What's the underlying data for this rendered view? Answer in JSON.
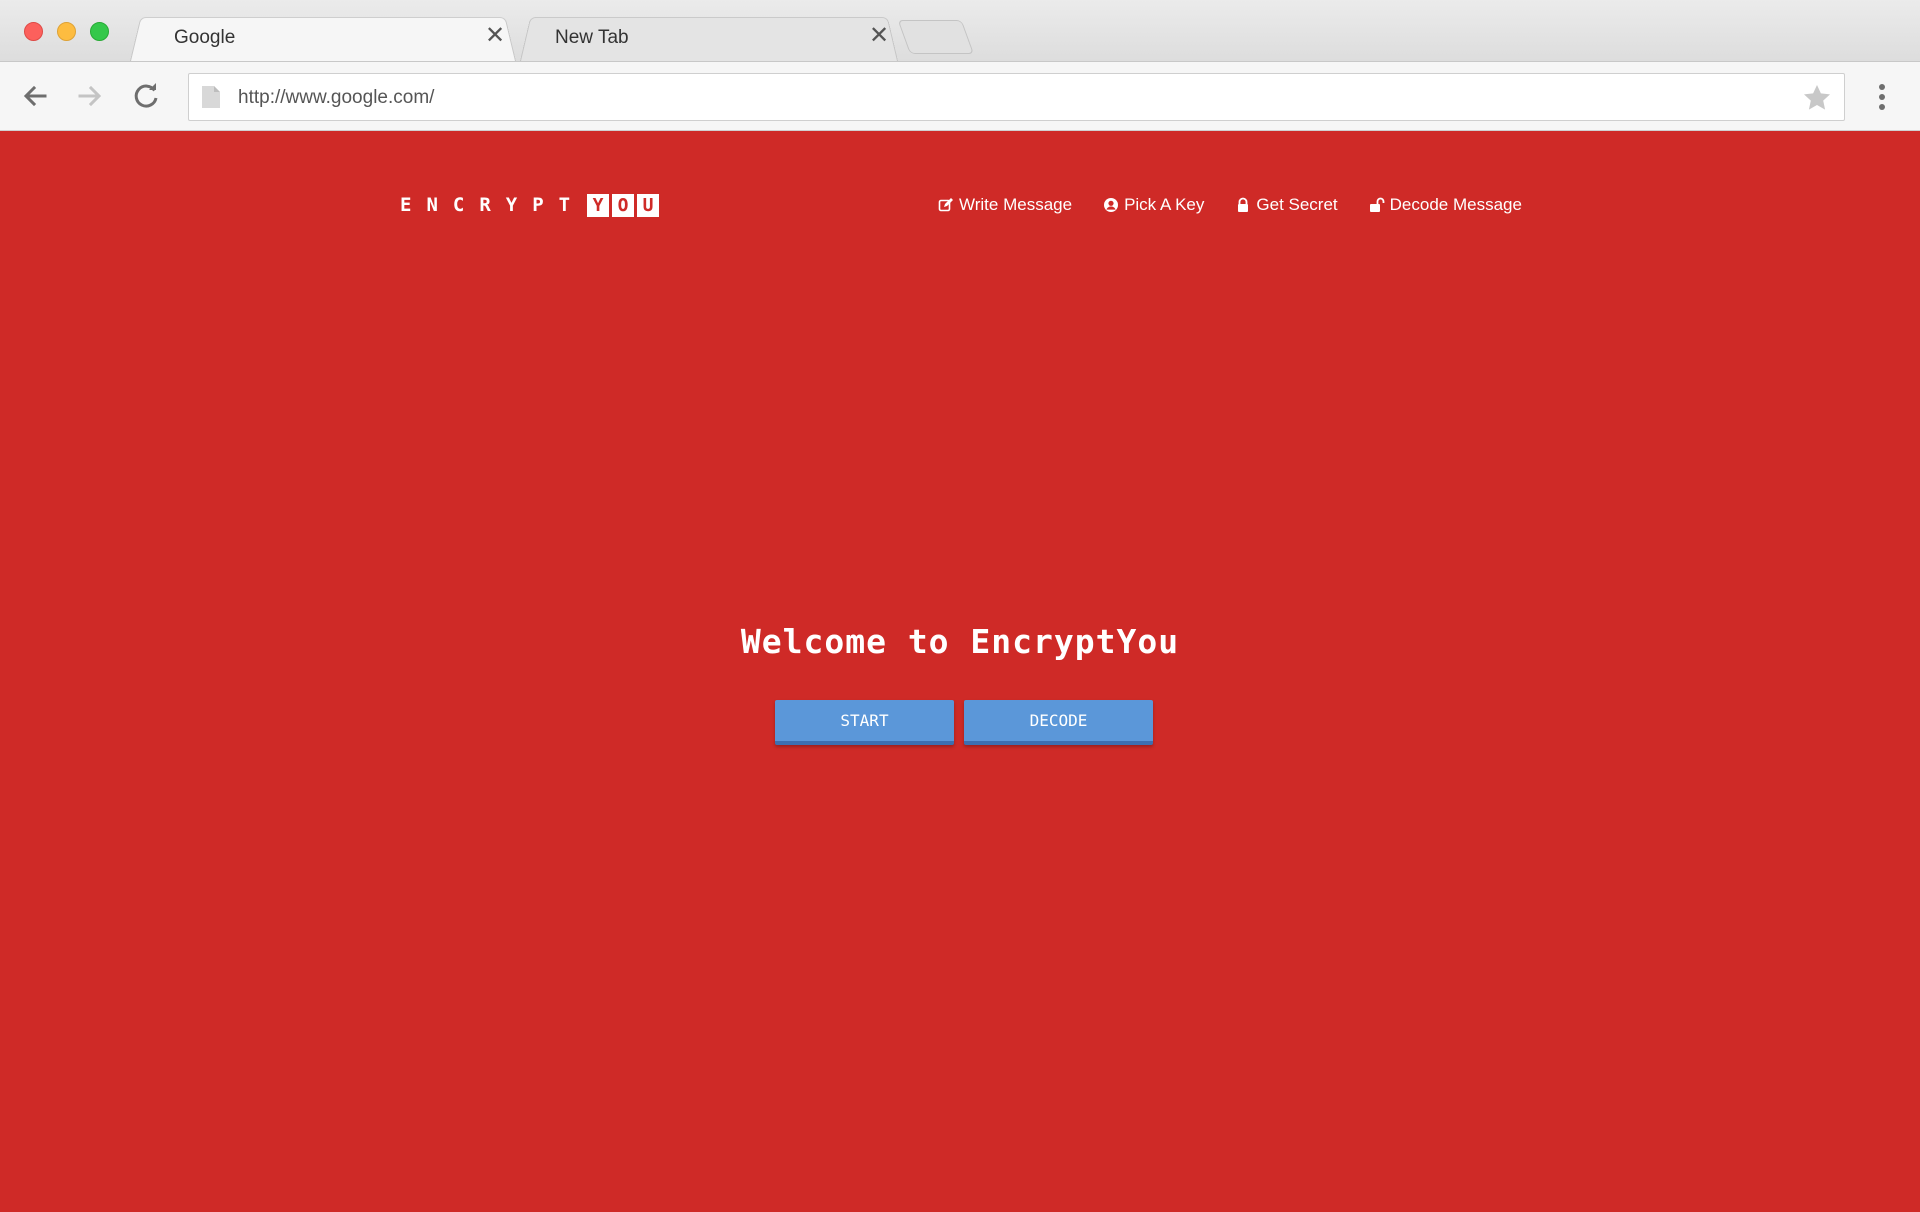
{
  "browser": {
    "tabs": [
      {
        "title": "Google",
        "active": true
      },
      {
        "title": "New Tab",
        "active": false
      }
    ],
    "close_glyph": "✕",
    "url": "http://www.google.com/",
    "icons": [
      "back-arrow-icon",
      "forward-arrow-icon",
      "reload-icon",
      "page-icon",
      "bookmark-star-icon",
      "menu-kebab-icon"
    ]
  },
  "site": {
    "logo": {
      "part1": "ENCRYPT",
      "part2": [
        "Y",
        "O",
        "U"
      ]
    },
    "nav": [
      {
        "label": "Write Message",
        "icon": "edit-icon"
      },
      {
        "label": "Pick A Key",
        "icon": "user-circle-icon"
      },
      {
        "label": "Get Secret",
        "icon": "lock-icon"
      },
      {
        "label": "Decode Message",
        "icon": "unlock-icon"
      }
    ],
    "heading": "Welcome to EncryptYou",
    "buttons": {
      "start": "START",
      "decode": "DECODE"
    },
    "colors": {
      "background": "#cf2a27",
      "button": "#5b97d9",
      "button_shadow": "#3d6fb0",
      "text": "#ffffff"
    }
  }
}
